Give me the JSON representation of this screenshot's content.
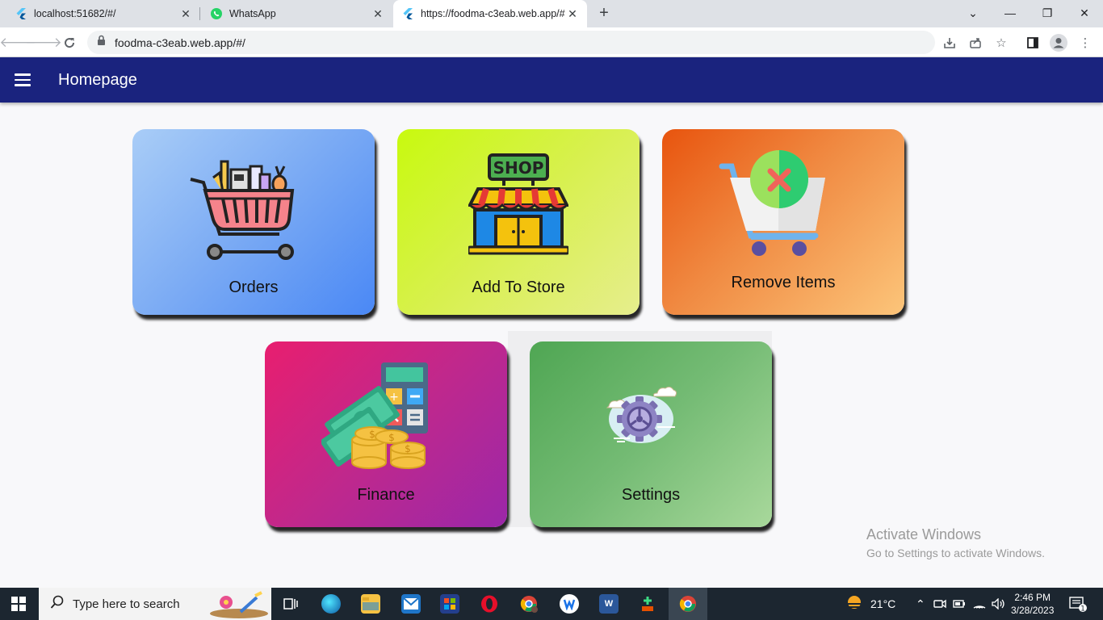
{
  "browser": {
    "tabs": [
      {
        "title": "localhost:51682/#/",
        "icon": "flutter-icon"
      },
      {
        "title": "WhatsApp",
        "icon": "whatsapp-icon"
      },
      {
        "title": "https://foodma-c3eab.web.app/#",
        "icon": "flutter-icon",
        "active": true
      }
    ],
    "new_tab": "+",
    "window_controls": {
      "dropdown": "⌄",
      "minimize": "—",
      "restore": "❐",
      "close": "✕"
    },
    "url": "foodma-c3eab.web.app/#/"
  },
  "app": {
    "title": "Homepage",
    "primary_color": "#1a237e",
    "cards": [
      {
        "label": "Orders",
        "icon": "shopping-cart-icon"
      },
      {
        "label": "Add To Store",
        "icon": "shop-icon"
      },
      {
        "label": "Remove Items",
        "icon": "remove-cart-icon"
      },
      {
        "label": "Finance",
        "icon": "money-calculator-icon"
      },
      {
        "label": "Settings",
        "icon": "gear-icon"
      }
    ]
  },
  "watermark": {
    "line1": "Activate Windows",
    "line2": "Go to Settings to activate Windows."
  },
  "taskbar": {
    "search_placeholder": "Type here to search",
    "weather": "21°C",
    "time": "2:46 PM",
    "date": "3/28/2023",
    "notifications": "1"
  }
}
